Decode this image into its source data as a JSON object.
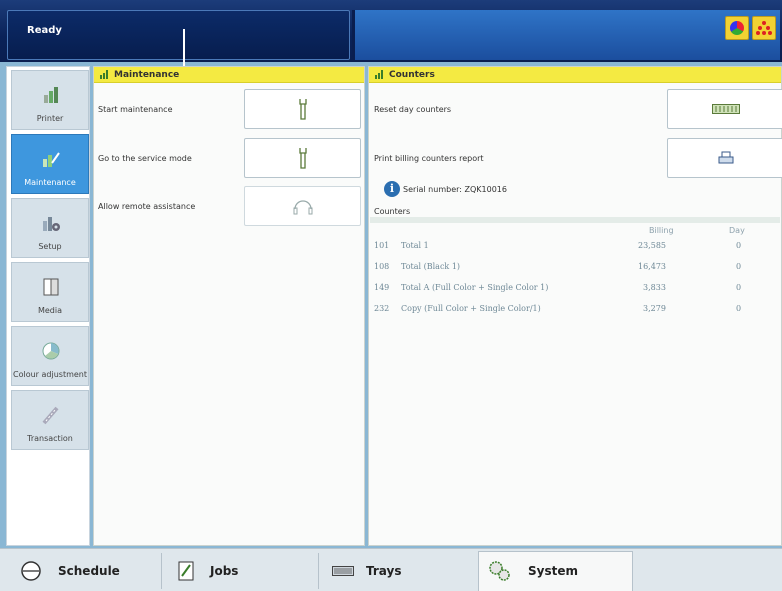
{
  "status": {
    "text": "Ready"
  },
  "top_icons": [
    "color-palette-icon",
    "dots-pattern-icon"
  ],
  "nav": {
    "items": [
      {
        "label": "Printer",
        "icon": "printer-icon",
        "active": false
      },
      {
        "label": "Maintenance",
        "icon": "maintenance-icon",
        "active": true
      },
      {
        "label": "Setup",
        "icon": "setup-icon",
        "active": false
      },
      {
        "label": "Media",
        "icon": "media-icon",
        "active": false
      },
      {
        "label": "Colour adjustment",
        "icon": "colour-adjustment-icon",
        "active": false
      },
      {
        "label": "Transaction",
        "icon": "transaction-icon",
        "active": false
      }
    ]
  },
  "maintenance": {
    "title": "Maintenance",
    "rows": [
      {
        "label": "Start maintenance",
        "icon": "wrench-icon"
      },
      {
        "label": "Go to the service mode",
        "icon": "wrench-icon"
      },
      {
        "label": "Allow remote assistance",
        "icon": "headset-icon"
      }
    ]
  },
  "counters": {
    "title": "Counters",
    "reset_label": "Reset day counters",
    "report_label": "Print billing counters report",
    "serial": "Serial number: ZQK10016",
    "section_label": "Counters",
    "columns": {
      "billing": "Billing",
      "day": "Day"
    },
    "rows": [
      {
        "id": "101",
        "name": "Total 1",
        "billing": "23,585",
        "day": "0"
      },
      {
        "id": "108",
        "name": "Total (Black 1)",
        "billing": "16,473",
        "day": "0"
      },
      {
        "id": "149",
        "name": "Total A (Full Color + Single Color 1)",
        "billing": "3,833",
        "day": "0"
      },
      {
        "id": "232",
        "name": "Copy (Full Color + Single Color/1)",
        "billing": "3,279",
        "day": "0"
      }
    ]
  },
  "bottom_tabs": [
    {
      "label": "Schedule",
      "icon": "schedule-icon"
    },
    {
      "label": "Jobs",
      "icon": "jobs-icon"
    },
    {
      "label": "Trays",
      "icon": "trays-icon"
    },
    {
      "label": "System",
      "icon": "system-gears-icon",
      "active": true
    }
  ]
}
